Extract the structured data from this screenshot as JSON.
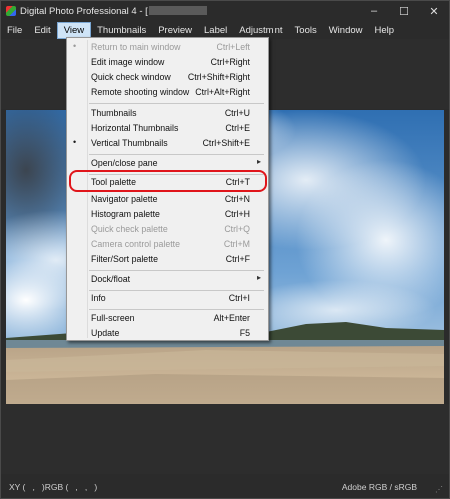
{
  "window": {
    "title_prefix": "Digital Photo Professional 4 - [",
    "controls": {
      "minimize": "–",
      "maximize": "☐",
      "close": "✕"
    }
  },
  "menubar": {
    "items": [
      {
        "label": "File"
      },
      {
        "label": "Edit"
      },
      {
        "label": "View",
        "active": true
      },
      {
        "label": "Thumbnails"
      },
      {
        "label": "Preview"
      },
      {
        "label": "Label"
      },
      {
        "label": "Adjustm"
      },
      {
        "label": "nt"
      },
      {
        "label": "Tools"
      },
      {
        "label": "Window"
      },
      {
        "label": "Help"
      }
    ]
  },
  "view_menu": {
    "items": [
      {
        "label": "Return to main window",
        "shortcut": "Ctrl+Left",
        "check": "•",
        "disabled": true
      },
      {
        "label": "Edit image window",
        "shortcut": "Ctrl+Right"
      },
      {
        "label": "Quick check window",
        "shortcut": "Ctrl+Shift+Right"
      },
      {
        "label": "Remote shooting window",
        "shortcut": "Ctrl+Alt+Right"
      },
      {
        "label": "Thumbnails",
        "shortcut": "Ctrl+U"
      },
      {
        "label": "Horizontal Thumbnails",
        "shortcut": "Ctrl+E"
      },
      {
        "label": "Vertical Thumbnails",
        "shortcut": "Ctrl+Shift+E",
        "check": "•"
      },
      {
        "label": "Open/close pane",
        "shortcut": "",
        "submenu": "▸"
      },
      {
        "label": "Tool palette",
        "shortcut": "Ctrl+T",
        "highlighted": true
      },
      {
        "label": "Navigator palette",
        "shortcut": "Ctrl+N"
      },
      {
        "label": "Histogram palette",
        "shortcut": "Ctrl+H"
      },
      {
        "label": "Quick check palette",
        "shortcut": "Ctrl+Q",
        "disabled": true
      },
      {
        "label": "Camera control palette",
        "shortcut": "Ctrl+M",
        "disabled": true
      },
      {
        "label": "Filter/Sort palette",
        "shortcut": "Ctrl+F"
      },
      {
        "label": "Dock/float",
        "shortcut": "",
        "submenu": "▸"
      },
      {
        "label": "Info",
        "shortcut": "Ctrl+I"
      },
      {
        "label": "Full-screen",
        "shortcut": "Alt+Enter"
      },
      {
        "label": "Update",
        "shortcut": "F5"
      }
    ]
  },
  "statusbar": {
    "xy_text": "XY (   ,   )RGB (   ,   ,   )",
    "color_profile": "Adobe RGB / sRGB"
  },
  "colors": {
    "highlight_ring": "#e0151b",
    "menu_bg": "#f0f0f0",
    "window_bg": "#2b2b2b"
  }
}
